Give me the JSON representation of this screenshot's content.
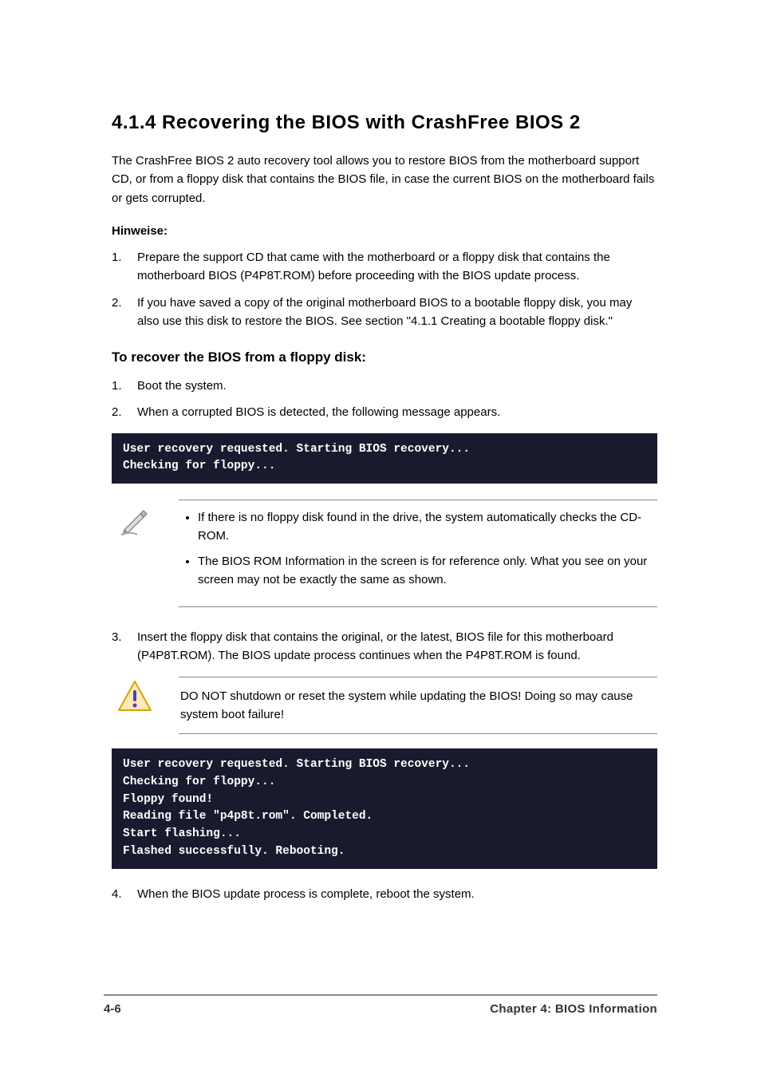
{
  "section": {
    "heading": "4.1.4 Recovering the BIOS with CrashFree BIOS 2",
    "intro": "The CrashFree BIOS 2 auto recovery tool allows you to restore BIOS from the motherboard support CD, or from a floppy disk that contains the BIOS file, in case the current BIOS on the motherboard fails or gets corrupted.",
    "hints_heading": "Hinweise:",
    "hints": [
      "Prepare the support CD that came with the motherboard or a floppy disk that contains the motherboard BIOS (P4P8T.ROM) before proceeding with the BIOS update process.",
      "If you have saved a copy of the original motherboard BIOS to a bootable floppy disk, you may also use this disk to restore the BIOS. See section \"4.1.1 Creating a bootable floppy disk.\""
    ],
    "sub1_heading": "To recover the BIOS from a floppy disk:",
    "steps1": [
      {
        "n": "1.",
        "t": "Boot the system."
      },
      {
        "n": "2.",
        "t": "When a corrupted BIOS is detected, the following message appears."
      }
    ],
    "terminal1": "User recovery requested. Starting BIOS recovery...\nChecking for floppy...",
    "note1": [
      "If there is no floppy disk found in the drive, the system automatically checks the CD-ROM.",
      "The BIOS ROM Information in the screen is for reference only. What you see on your screen may not be exactly the same as shown."
    ],
    "cont_text": "3. Insert the floppy disk that contains the original, or the latest, BIOS file for this motherboard (P4P8T.ROM). The BIOS update process continues when the P4P8T.ROM is found.",
    "warn_text": "DO NOT shutdown or reset the system while updating the BIOS! Doing so may cause system boot failure!",
    "terminal2": "User recovery requested. Starting BIOS recovery...\nChecking for floppy...\nFloppy found!\nReading file \"p4p8t.rom\". Completed.\nStart flashing...\nFlashed successfully. Rebooting.",
    "step4": {
      "n": "4.",
      "t": "When the BIOS update process is complete, reboot the system."
    }
  },
  "footer": {
    "left": "4-6",
    "right": "Chapter 4: BIOS Information"
  }
}
